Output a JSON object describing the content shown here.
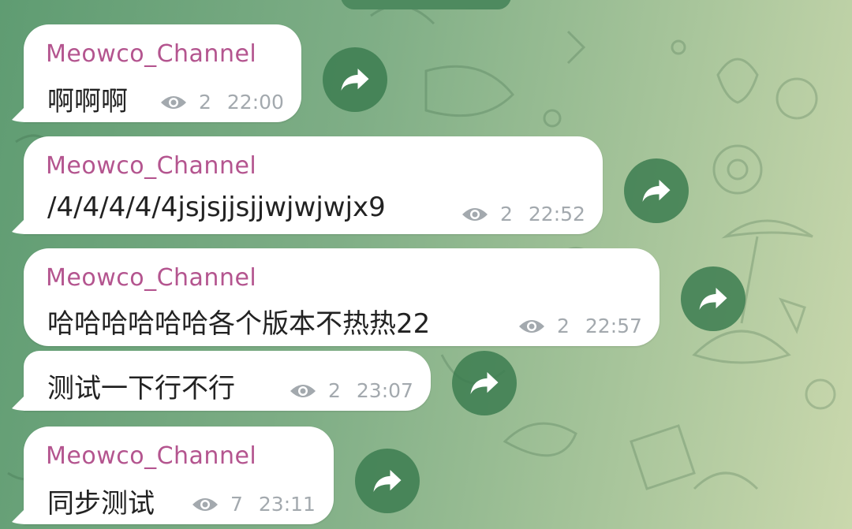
{
  "chat": {
    "messages": [
      {
        "author": "Meowco_Channel",
        "text": "啊啊啊",
        "views": "2",
        "time": "22:00"
      },
      {
        "author": "Meowco_Channel",
        "text": "/4/4/4/4/4jsjsjjsjjwjwjwjx9",
        "views": "2",
        "time": "22:52"
      },
      {
        "author": "Meowco_Channel",
        "text": "哈哈哈哈哈哈各个版本不热热22",
        "views": "2",
        "time": "22:57"
      },
      {
        "author": "",
        "text": "测试一下行不行",
        "views": "2",
        "time": "23:07"
      },
      {
        "author": "Meowco_Channel",
        "text": "同步测试",
        "views": "7",
        "time": "23:11"
      }
    ]
  },
  "icons": {
    "views": "eye-icon",
    "forward": "forward-arrow-icon"
  },
  "colors": {
    "author": "#b4558f",
    "meta": "#a3a9ae",
    "bubble": "#ffffff",
    "forward_button": "#3c7d50"
  }
}
